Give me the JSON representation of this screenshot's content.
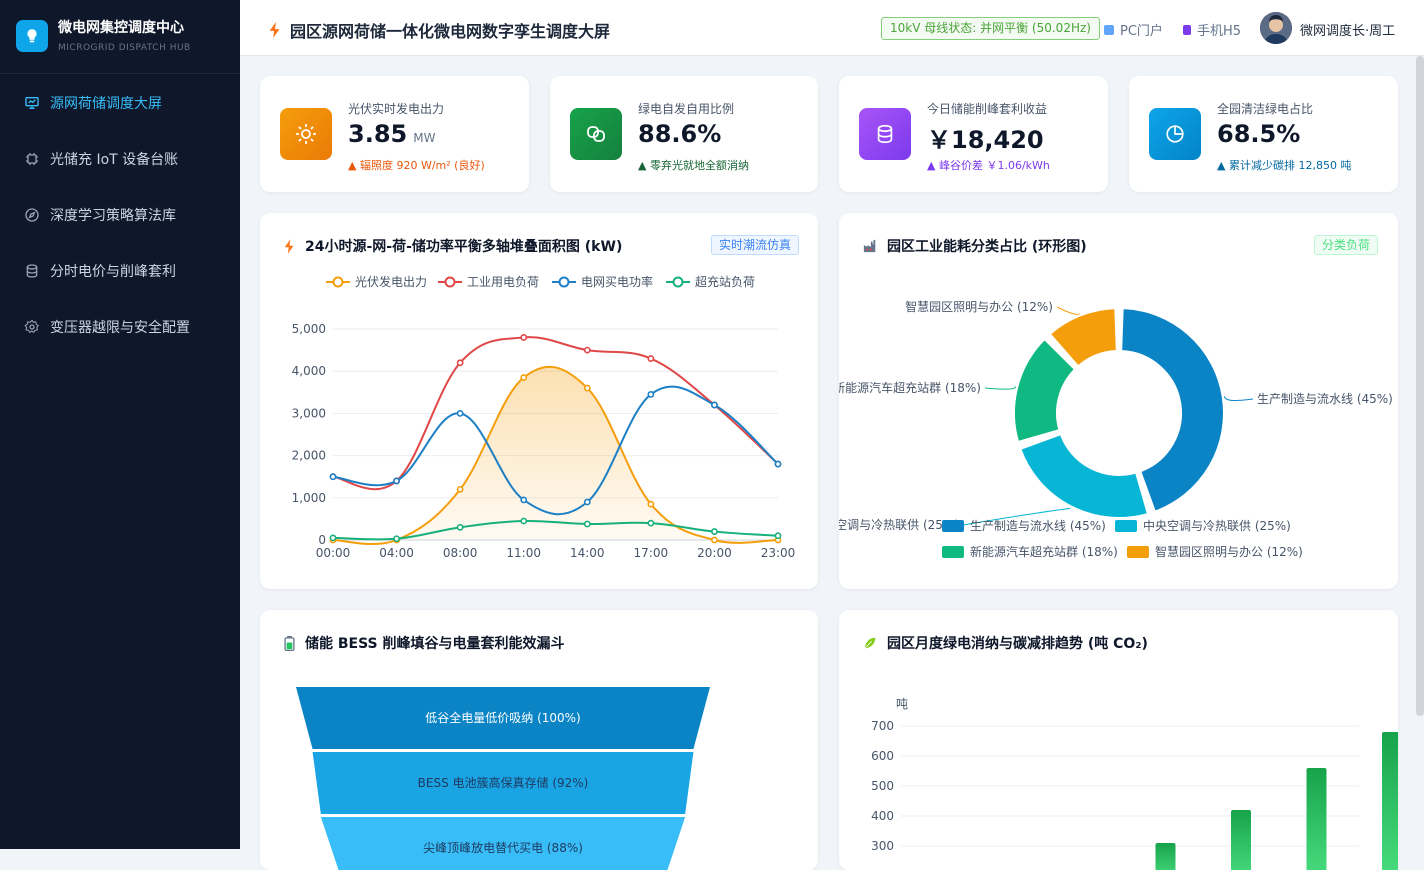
{
  "brand": {
    "title": "微电网集控调度中心",
    "subtitle": "MICROGRID DISPATCH HUB"
  },
  "nav": [
    {
      "label": "源网荷储调度大屏",
      "active": true
    },
    {
      "label": "光储充 IoT 设备台账"
    },
    {
      "label": "深度学习策略算法库"
    },
    {
      "label": "分时电价与削峰套利"
    },
    {
      "label": "变压器越限与安全配置"
    }
  ],
  "header": {
    "title": "园区源网荷储一体化微电网数字孪生调度大屏",
    "status": "10kV 母线状态: 并网平衡 (50.02Hz)",
    "link_pc": "PC门户",
    "link_h5": "手机H5",
    "user": "微网调度长·周工"
  },
  "kpis": [
    {
      "label": "光伏实时发电出力",
      "value": "3.85",
      "unit": "MW",
      "note": "▲ 辐照度 920 W/m² (良好)",
      "color": "#ea580c",
      "icon": "sun-icon",
      "bg": "#f59e0b"
    },
    {
      "label": "绿电自发自用比例",
      "value": "88.6%",
      "unit": "",
      "note": "▲ 零弃光就地全额消纳",
      "color": "#166534",
      "icon": "cycle-icon",
      "bg": "#16a34a"
    },
    {
      "label": "今日储能削峰套利收益",
      "value": "￥18,420",
      "unit": "",
      "note": "▲ 峰谷价差 ￥1.06/kWh",
      "color": "#7c3aed",
      "icon": "database-icon",
      "bg": "#8b5cf6"
    },
    {
      "label": "全园清洁绿电占比",
      "value": "68.5%",
      "unit": "",
      "note": "▲ 累计减少碳排 12,850 吨",
      "color": "#0369a1",
      "icon": "pie-icon",
      "bg": "#0ea5e9"
    }
  ],
  "panels": {
    "line": {
      "title": "24小时源-网-荷-储功率平衡多轴堆叠面积图 (kW)",
      "tag": "实时潮流仿真"
    },
    "donut": {
      "title": "园区工业能耗分类占比 (环形图)",
      "tag": "分类负荷"
    },
    "funnel": {
      "title": "储能 BESS 削峰填谷与电量套利能效漏斗"
    },
    "bar": {
      "title": "园区月度绿电消纳与碳减排趋势 (吨 CO₂)"
    }
  },
  "chart_data": [
    {
      "type": "area",
      "categories": [
        "00:00",
        "04:00",
        "08:00",
        "11:00",
        "14:00",
        "17:00",
        "20:00",
        "23:00"
      ],
      "ylim": [
        0,
        5000
      ],
      "yticks": [
        "0",
        "1,000",
        "2,000",
        "3,000",
        "4,000",
        "5,000"
      ],
      "legend_position": "top",
      "grid": true,
      "series": [
        {
          "name": "光伏发电出力",
          "color": "#f59e0b",
          "values": [
            0,
            0,
            1200,
            3850,
            3600,
            850,
            0,
            0
          ],
          "area": true
        },
        {
          "name": "工业用电负荷",
          "color": "#e04848",
          "values": [
            1500,
            1400,
            4200,
            4800,
            4500,
            4300,
            3200,
            1800
          ]
        },
        {
          "name": "电网买电功率",
          "color": "#1d7fc4",
          "values": [
            1500,
            1400,
            3000,
            950,
            900,
            3450,
            3200,
            1800
          ]
        },
        {
          "name": "超充站负荷",
          "color": "#16b07a",
          "values": [
            50,
            30,
            300,
            450,
            380,
            400,
            200,
            100
          ]
        }
      ]
    },
    {
      "type": "pie",
      "donut": true,
      "series": [
        {
          "name": "生产制造与流水线",
          "value": 45,
          "color": "#0b84c6",
          "label": "生产制造与流水线 (45%)"
        },
        {
          "name": "中央空调与冷热联供",
          "value": 25,
          "color": "#06b6d4",
          "label": "中央空调与冷热联供 (25%)"
        },
        {
          "name": "新能源汽车超充站群",
          "value": 18,
          "color": "#10b981",
          "label": "新能源汽车超充站群 (18%)"
        },
        {
          "name": "智慧园区照明与办公",
          "value": 12,
          "color": "#f59e0b",
          "label": "智慧园区照明与办公 (12%)"
        }
      ]
    },
    {
      "type": "funnel",
      "series": [
        {
          "label": "低谷全电量低价吸纳 (100%)",
          "value": 100,
          "color": "#0b84c6",
          "text_color": "#ffffff"
        },
        {
          "label": "BESS 电池簇高保真存储 (92%)",
          "value": 92,
          "color": "#1aa4e4",
          "text_color": "#1e3a5f"
        },
        {
          "label": "尖峰顶峰放电替代买电 (88%)",
          "value": 88,
          "color": "#38bdf8",
          "text_color": "#1e3a5f"
        }
      ]
    },
    {
      "type": "bar",
      "ylabel": "吨",
      "ylim": [
        0,
        700
      ],
      "yticks": [
        "700",
        "600",
        "500",
        "400",
        "300"
      ],
      "grid": true,
      "color": "#16a34a",
      "values": [
        null,
        null,
        null,
        310,
        420,
        560,
        680
      ]
    }
  ]
}
